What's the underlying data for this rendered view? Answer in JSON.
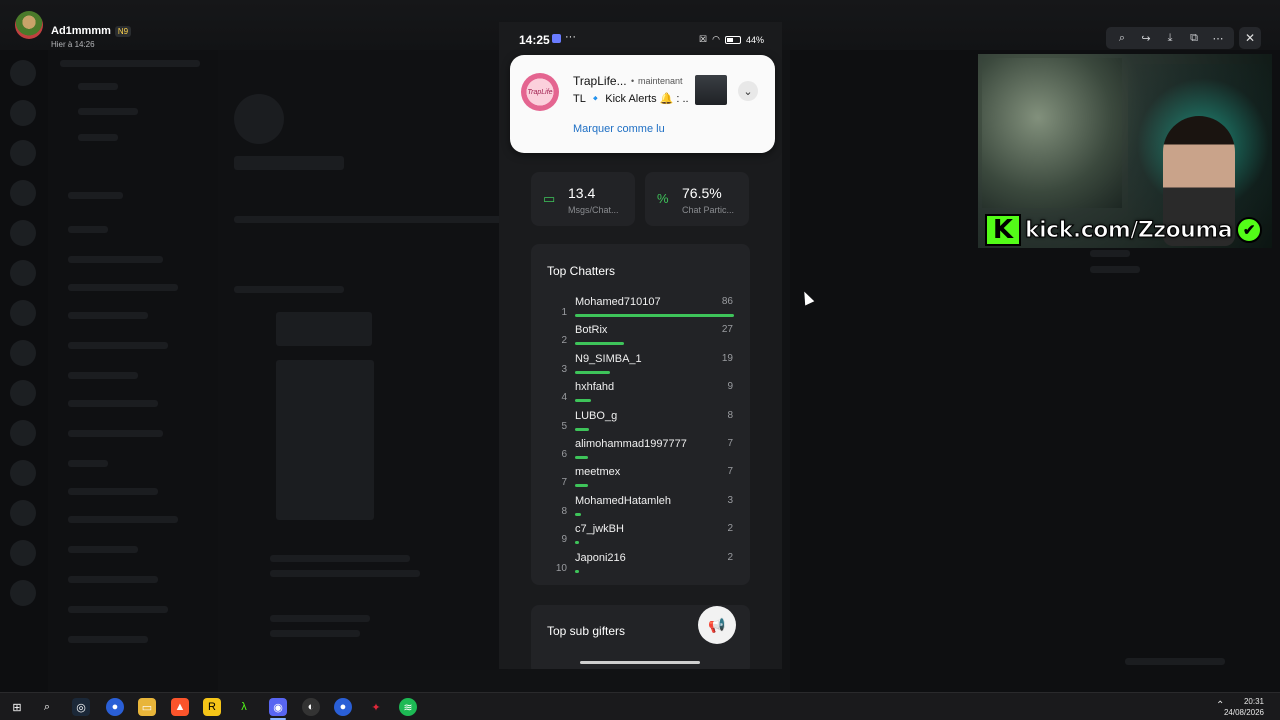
{
  "viewer": {
    "user_name": "Ad1mmmm",
    "user_badge": "N9",
    "timestamp": "Hier à 14:26",
    "toolbar_icons": [
      "zoom-icon",
      "forward-icon",
      "download-icon",
      "open-external-icon",
      "more-icon"
    ],
    "close_icon": "close-icon"
  },
  "phone": {
    "status_time": "14:25",
    "status_dots": "···",
    "battery": "44%",
    "notification": {
      "app": "TrapLife...",
      "separator": "•",
      "when": "maintenant",
      "body": "TL 🔹 Kick Alerts 🔔 : ..",
      "action": "Marquer comme lu",
      "icon_text": "TrapLife"
    },
    "stats": [
      {
        "value": "13.4",
        "label": "Msgs/Chat...",
        "icon": "chat-icon"
      },
      {
        "value": "76.5%",
        "label": "Chat Partic...",
        "icon": "percent-icon"
      }
    ],
    "top_chatters": {
      "title": "Top Chatters",
      "rows": [
        {
          "rank": "1",
          "name": "Mohamed710107",
          "count": "86",
          "share": 1.0
        },
        {
          "rank": "2",
          "name": "BotRix",
          "count": "27",
          "share": 0.31
        },
        {
          "rank": "3",
          "name": "N9_SIMBA_1",
          "count": "19",
          "share": 0.22
        },
        {
          "rank": "4",
          "name": "hxhfahd",
          "count": "9",
          "share": 0.1
        },
        {
          "rank": "5",
          "name": "LUBO_g",
          "count": "8",
          "share": 0.09
        },
        {
          "rank": "6",
          "name": "alimohammad1997777",
          "count": "7",
          "share": 0.08
        },
        {
          "rank": "7",
          "name": "meetmex",
          "count": "7",
          "share": 0.08
        },
        {
          "rank": "8",
          "name": "MohamedHatamleh",
          "count": "3",
          "share": 0.035
        },
        {
          "rank": "9",
          "name": "c7_jwkBH",
          "count": "2",
          "share": 0.025
        },
        {
          "rank": "10",
          "name": "Japoni216",
          "count": "2",
          "share": 0.025
        }
      ]
    },
    "sub_gifters": {
      "title": "Top sub gifters",
      "fab_icon": "megaphone-icon"
    }
  },
  "stream_overlay": {
    "k_letter": "K",
    "url": "kick.com/Zzouma",
    "check": "✔",
    "accent_color": "#53fc18"
  },
  "taskbar": {
    "time": "20:31",
    "date": "24/08/2026",
    "apps": [
      "windows-start-icon",
      "search-icon",
      "steam-icon",
      "chrome-icon",
      "file-explorer-icon",
      "brave-icon",
      "rockstar-icon",
      "app-icon",
      "discord-icon",
      "obs-icon",
      "chrome-icon",
      "app-red-icon",
      "spotify-icon"
    ]
  }
}
